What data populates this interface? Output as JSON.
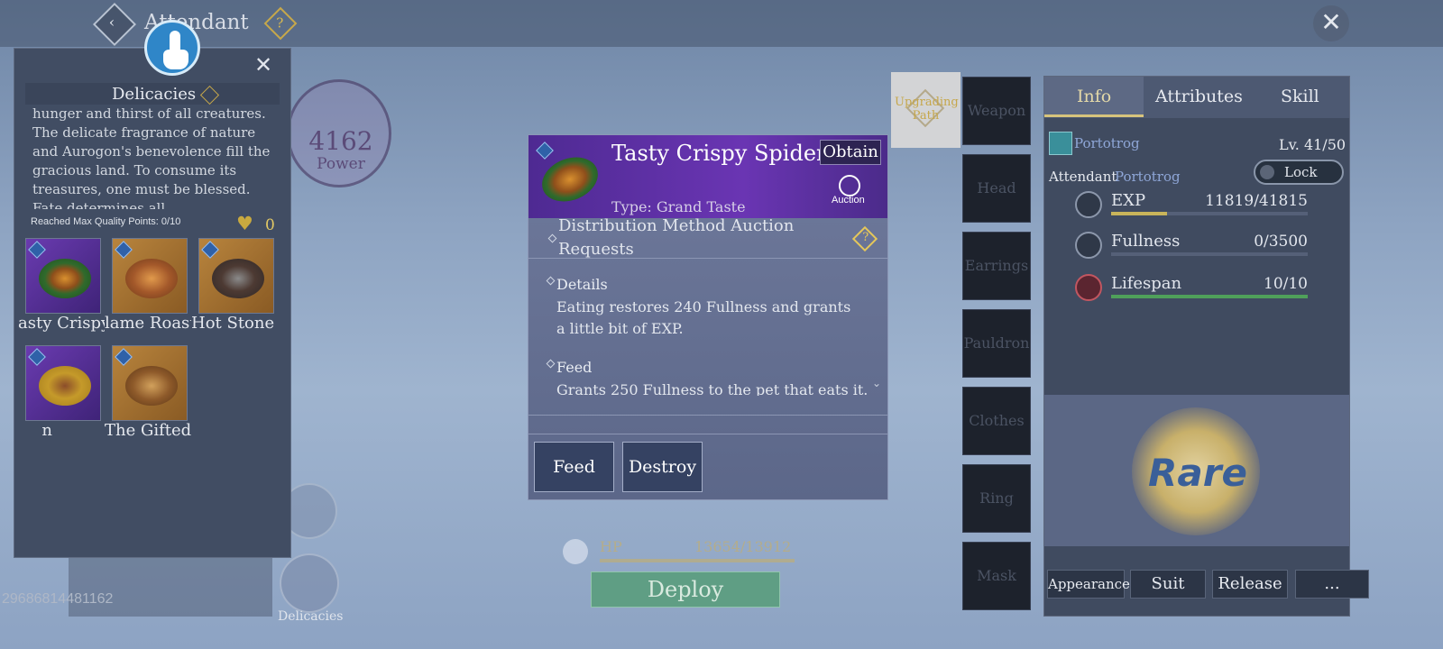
{
  "topbar": {
    "title": "Attendant",
    "back_glyph": "‹",
    "help_glyph": "?",
    "close_glyph": "✕"
  },
  "power": {
    "value": "4162",
    "label": "Power"
  },
  "delicacies": {
    "title": "Delicacies",
    "description": "hunger and thirst of all creatures. The delicate fragrance of nature and Aurogon's benevolence fill the gracious land. To consume its treasures, one must be blessed. Fate determines all.",
    "quality_text": "Reached Max Quality Points: 0/10",
    "heart_count": "0",
    "items": [
      {
        "label": "Tasty Crispy Spider",
        "display": "asty Crispy",
        "rarity": "purple"
      },
      {
        "label": "Flame Roast",
        "display": "lame Roast",
        "rarity": "orange"
      },
      {
        "label": "Hot Stone I",
        "display": "Hot Stone I",
        "rarity": "orange"
      },
      {
        "label": "n",
        "display": "n",
        "rarity": "purple"
      },
      {
        "label": "The Gifted",
        "display": "The Gifted",
        "rarity": "orange"
      }
    ],
    "close_glyph": "✕"
  },
  "player_id": "29686814481162",
  "bottom_left": {
    "delicacies_label": "Delicacies"
  },
  "item_popup": {
    "name": "Tasty Crispy Spider",
    "obtain_label": "Obtain",
    "auction_label": "Auction",
    "type_text": "Type: Grand Taste",
    "distribution_text": "Distribution Method    Auction Requests",
    "details_title": "Details",
    "details_text": "Eating restores 240 Fullness and grants a little bit of EXP.",
    "feed_title": "Feed",
    "feed_text": "Grants 250 Fullness to the pet that eats it.",
    "feed_button": "Feed",
    "destroy_button": "Destroy"
  },
  "bottom_center": {
    "hp_label": "HP",
    "hp_value": "13654/13912",
    "deploy_label": "Deploy"
  },
  "equipment": {
    "upgrading_path": "Upgrading Path",
    "slots": [
      "Weapon",
      "Head",
      "Earrings",
      "Pauldron",
      "Clothes",
      "Ring",
      "Mask"
    ]
  },
  "info_panel": {
    "tabs": [
      "Info",
      "Attributes",
      "Skill"
    ],
    "pet_name": "Portotrog",
    "level": "Lv. 41/50",
    "attendant_label": "Attendant",
    "attendant_name": "Portotrog",
    "lock_label": "Lock",
    "stats": [
      {
        "name": "EXP",
        "value": "11819/41815",
        "fraction": 0.283,
        "color": "#c9b45a"
      },
      {
        "name": "Fullness",
        "value": "0/3500",
        "fraction": 0.0,
        "color": "#c9b45a"
      },
      {
        "name": "Lifespan",
        "value": "10/10",
        "fraction": 1.0,
        "color": "#4fa05a"
      }
    ],
    "rarity_text": "Rare",
    "buttons": [
      "Appearance",
      "Suit",
      "Release",
      "..."
    ]
  },
  "colors": {
    "accent_gold": "#c8a93f",
    "rare_blue": "#3a5f99",
    "popup_purple": "#6a35b3"
  }
}
